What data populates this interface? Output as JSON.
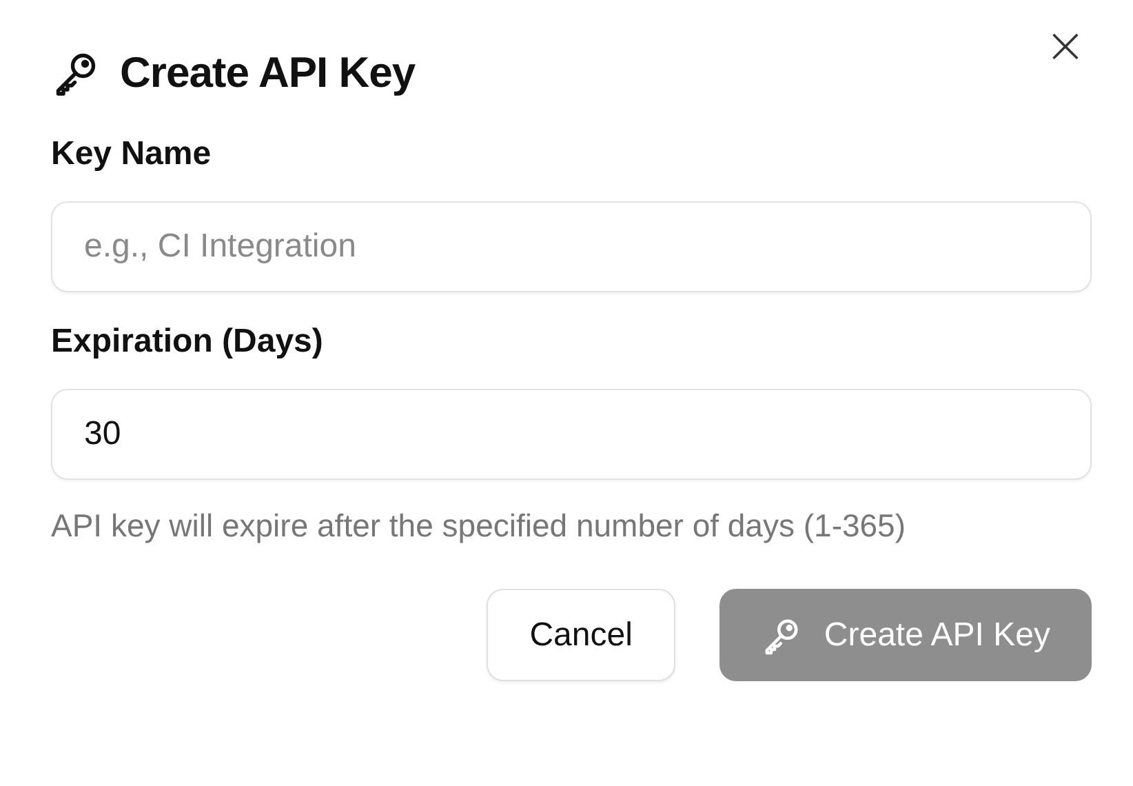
{
  "dialog": {
    "title": "Create API Key",
    "close": "×"
  },
  "fields": [
    {
      "label": "Key Name",
      "placeholder": "e.g., CI Integration"
    },
    {
      "label": "Expiration (Days)",
      "value": "30",
      "help": "API key will expire after the specified number of days (1-365)"
    }
  ],
  "buttons": [
    {
      "label": "Cancel",
      "kind": "secondary",
      "disabled": false
    },
    {
      "label": "Create API Key",
      "kind": "primary",
      "disabled": true
    }
  ]
}
